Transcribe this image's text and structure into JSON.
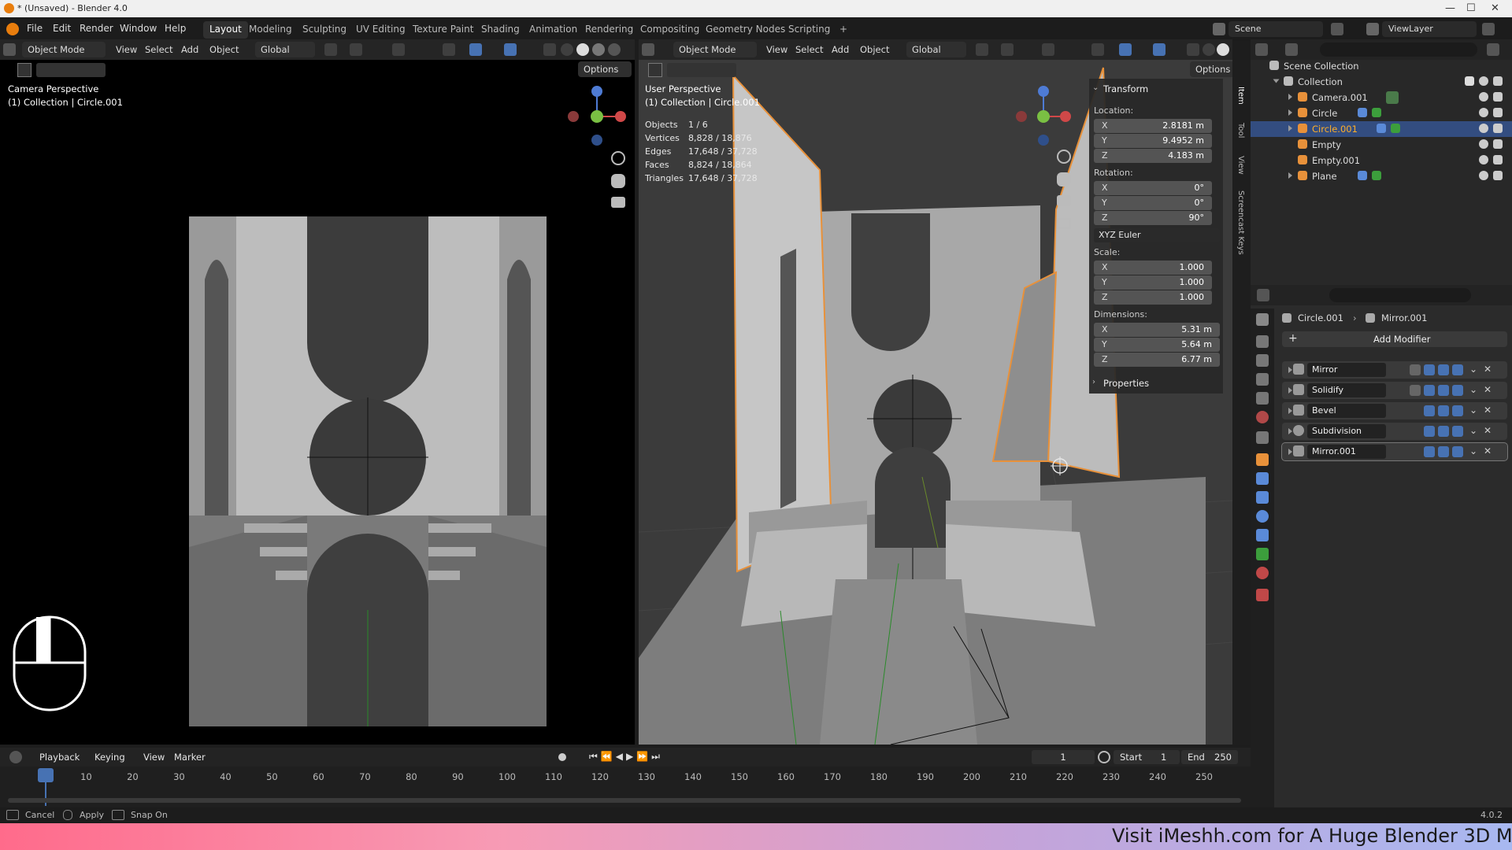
{
  "window": {
    "title": "* (Unsaved) - Blender 4.0"
  },
  "menu": [
    "File",
    "Edit",
    "Render",
    "Window",
    "Help"
  ],
  "workspaces": [
    "Layout",
    "Modeling",
    "Sculpting",
    "UV Editing",
    "Texture Paint",
    "Shading",
    "Animation",
    "Rendering",
    "Compositing",
    "Geometry Nodes",
    "Scripting",
    "+"
  ],
  "scene": "Scene",
  "view_layer": "ViewLayer",
  "left_viewport": {
    "header": {
      "mode": "Object Mode",
      "menus": [
        "View",
        "Select",
        "Add",
        "Object"
      ],
      "orientation": "Global",
      "options": "Options"
    },
    "overlay_title": "Camera Perspective",
    "overlay_sub": "(1) Collection | Circle.001"
  },
  "right_viewport": {
    "header": {
      "mode": "Object Mode",
      "menus": [
        "View",
        "Select",
        "Add",
        "Object"
      ],
      "orientation": "Global",
      "options": "Options"
    },
    "overlay_title": "User Perspective",
    "overlay_sub": "(1) Collection | Circle.001",
    "stats": [
      {
        "label": "Objects",
        "value": "1 / 6"
      },
      {
        "label": "Vertices",
        "value": "8,828 / 18,876"
      },
      {
        "label": "Edges",
        "value": "17,648 / 37,728"
      },
      {
        "label": "Faces",
        "value": "8,824 / 18,864"
      },
      {
        "label": "Triangles",
        "value": "17,648 / 37,728"
      }
    ],
    "transform": {
      "title": "Transform",
      "location_label": "Location:",
      "location": [
        {
          "axis": "X",
          "value": "2.8181 m"
        },
        {
          "axis": "Y",
          "value": "9.4952 m"
        },
        {
          "axis": "Z",
          "value": "4.183 m"
        }
      ],
      "rotation_label": "Rotation:",
      "rotation": [
        {
          "axis": "X",
          "value": "0°"
        },
        {
          "axis": "Y",
          "value": "0°"
        },
        {
          "axis": "Z",
          "value": "90°"
        }
      ],
      "rotation_mode": "XYZ Euler",
      "scale_label": "Scale:",
      "scale": [
        {
          "axis": "X",
          "value": "1.000"
        },
        {
          "axis": "Y",
          "value": "1.000"
        },
        {
          "axis": "Z",
          "value": "1.000"
        }
      ],
      "dimensions_label": "Dimensions:",
      "dimensions": [
        {
          "axis": "X",
          "value": "5.31 m"
        },
        {
          "axis": "Y",
          "value": "5.64 m"
        },
        {
          "axis": "Z",
          "value": "6.77 m"
        }
      ],
      "properties_label": "Properties"
    },
    "side_tabs": [
      "Item",
      "Tool",
      "View",
      "Screencast Keys"
    ]
  },
  "outliner": {
    "root": "Scene Collection",
    "collection": "Collection",
    "items": [
      "Camera.001",
      "Circle",
      "Circle.001",
      "Empty",
      "Empty.001",
      "Plane"
    ],
    "selected": "Circle.001"
  },
  "properties": {
    "breadcrumb_object": "Circle.001",
    "breadcrumb_modifier": "Mirror.001",
    "add_modifier": "Add Modifier",
    "modifiers": [
      "Mirror",
      "Solidify",
      "Bevel",
      "Subdivision",
      "Mirror.001"
    ]
  },
  "timeline": {
    "menus": [
      "Playback",
      "Keying",
      "View",
      "Marker"
    ],
    "current_frame": "1",
    "start_label": "Start",
    "start": "1",
    "end_label": "End",
    "end": "250",
    "ticks": [
      "1",
      "10",
      "20",
      "30",
      "40",
      "50",
      "60",
      "70",
      "80",
      "90",
      "100",
      "110",
      "120",
      "130",
      "140",
      "150",
      "160",
      "170",
      "180",
      "190",
      "200",
      "210",
      "220",
      "230",
      "240",
      "250"
    ]
  },
  "status_bar": {
    "items": [
      "Cancel",
      "Apply",
      "Snap On"
    ],
    "version": "4.0.2"
  },
  "banner": "Visit iMeshh.com for A Huge Blender 3D M",
  "colors": {
    "accent": "#4772b3",
    "selection_orange": "#e8913a",
    "selected_row": "#334d80"
  }
}
